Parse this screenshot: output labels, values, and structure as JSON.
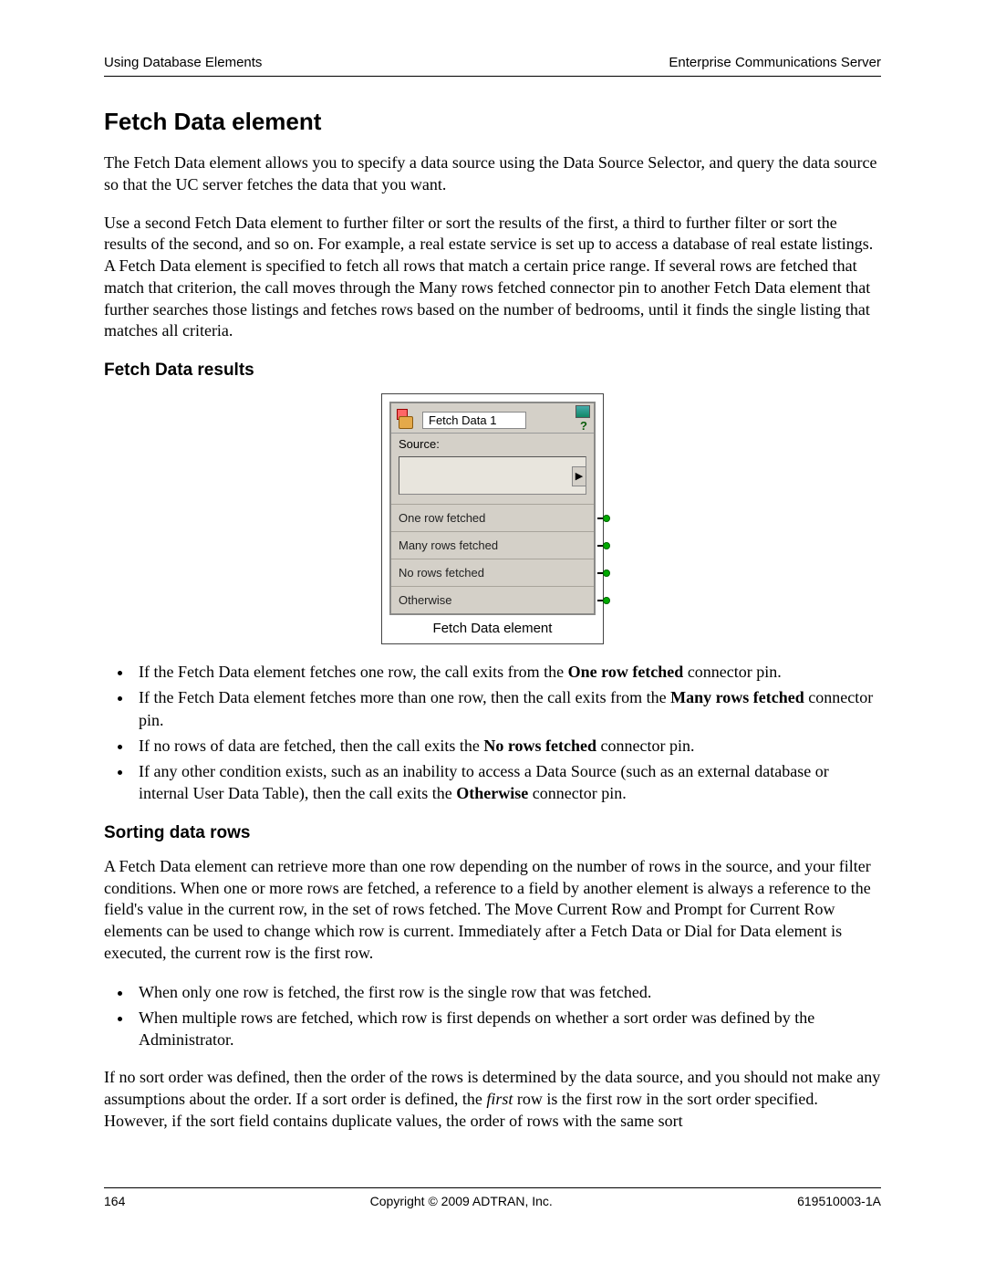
{
  "header": {
    "left": "Using Database Elements",
    "right": "Enterprise Communications Server"
  },
  "title": "Fetch Data element",
  "intro1": "The Fetch Data element allows you to specify a data source using the Data Source Selector, and query the data source so that the UC server fetches the data that you want.",
  "intro2": "Use a second Fetch Data element to further filter or sort the results of the first, a third to further filter or sort the results of the second, and so on. For example, a real estate service is set up to access a database of real estate listings. A Fetch Data element is specified to fetch all rows that match a certain price range. If several rows are fetched that match that criterion, the call moves through the Many rows fetched connector pin to another Fetch Data element that further searches those listings and fetches rows based on the number of bedrooms, until it finds the single listing that matches all criteria.",
  "section1": "Fetch Data results",
  "widget": {
    "title": "Fetch Data 1",
    "sourceLabel": "Source:",
    "rows": [
      "One row fetched",
      "Many rows fetched",
      "No rows fetched",
      "Otherwise"
    ],
    "caption": "Fetch Data element"
  },
  "bullets1": {
    "b1a": "If the Fetch Data element fetches one row, the call exits from the ",
    "b1b": "One row fetched",
    "b1c": " connector pin.",
    "b2a": "If the Fetch Data element fetches more than one row, then the call exits from the ",
    "b2b": "Many rows fetched",
    "b2c": " connector pin.",
    "b3a": "If no rows of data are fetched, then the call exits the ",
    "b3b": "No rows fetched",
    "b3c": " connector pin.",
    "b4a": "If any other condition exists, such as an inability to access a Data Source (such as an external database or internal User Data Table), then the call exits the ",
    "b4b": "Otherwise",
    "b4c": " connector pin."
  },
  "section2": "Sorting data rows",
  "sorting1": "A Fetch Data element can retrieve more than one row depending on the number of rows in the source, and your filter conditions. When one or more rows are fetched, a reference to a field by another element is always a reference to the field's value in the current row, in the set of rows fetched. The Move Current Row and Prompt for Current Row elements can be used to change which row is current. Immediately after a Fetch Data or Dial for Data element is executed, the current row is the first row.",
  "bullets2": {
    "b1": "When only one row is fetched, the first row is the single row that was fetched.",
    "b2": "When multiple rows are fetched, which row is first depends on whether a sort order was defined by the Administrator."
  },
  "sorting2a": "If no sort order was defined, then the order of the rows is determined by the data source, and you should not make any assumptions about the order. If a sort order is defined, the ",
  "sorting2b": "first",
  "sorting2c": " row is the first row in the sort order specified. However, if the sort field contains duplicate values, the order of rows with the same sort",
  "footer": {
    "page": "164",
    "center": "Copyright © 2009 ADTRAN, Inc.",
    "right": "619510003-1A"
  }
}
